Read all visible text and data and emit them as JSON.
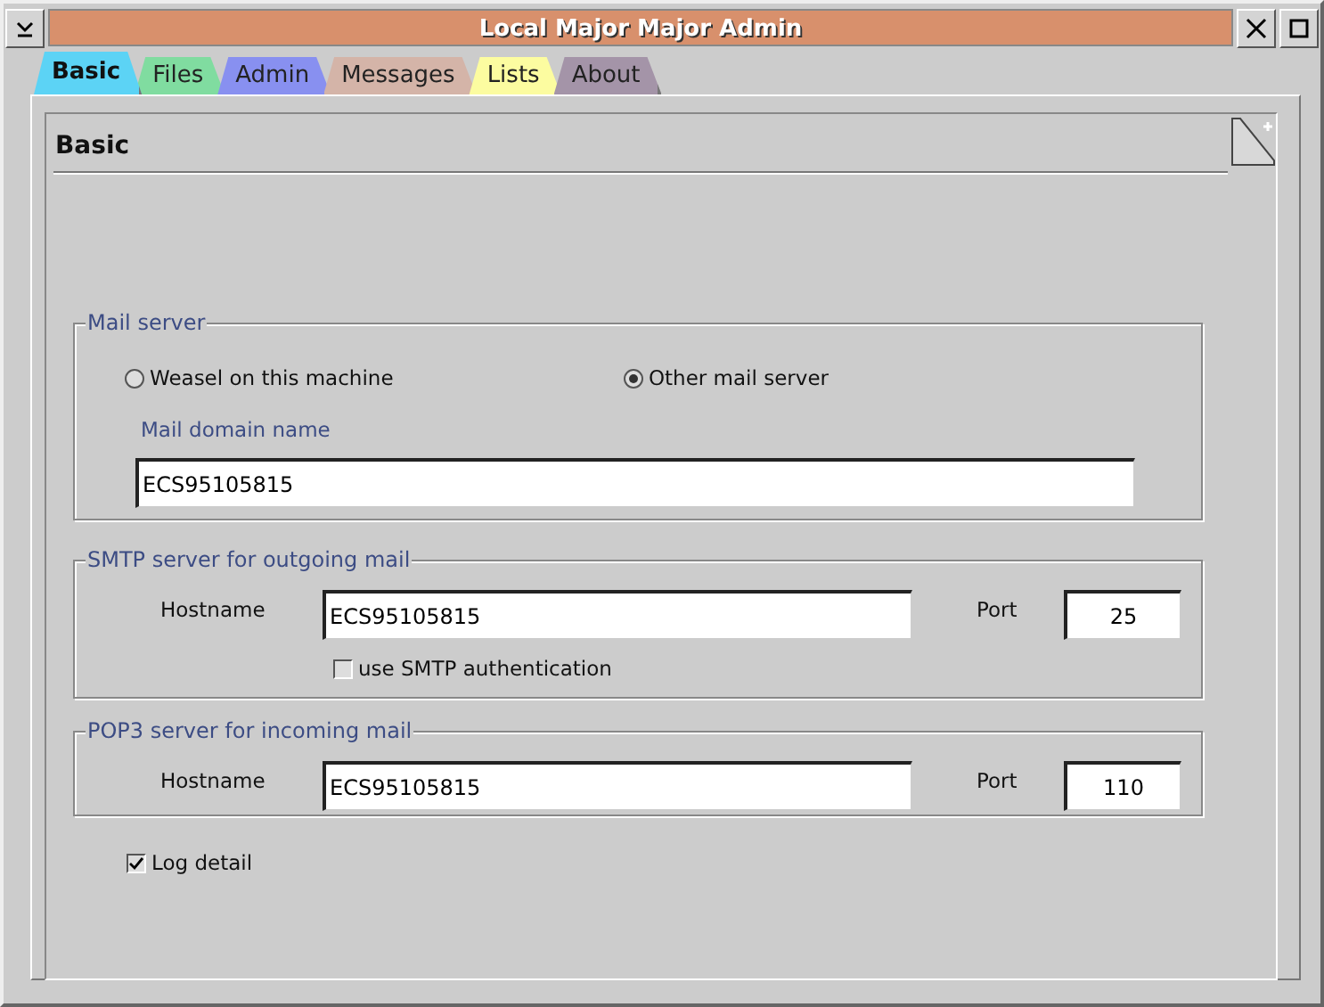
{
  "window": {
    "title": "Local Major Major Admin"
  },
  "tabs": [
    {
      "label": "Basic",
      "selected": true,
      "color": "#5cd3f5"
    },
    {
      "label": "Files",
      "selected": false,
      "color": "#80dca0"
    },
    {
      "label": "Admin",
      "selected": false,
      "color": "#8890f0"
    },
    {
      "label": "Messages",
      "selected": false,
      "color": "#d4b4a8"
    },
    {
      "label": "Lists",
      "selected": false,
      "color": "#fcfca0"
    },
    {
      "label": "About",
      "selected": false,
      "color": "#a494a8"
    }
  ],
  "page": {
    "title": "Basic"
  },
  "mail_server": {
    "legend": "Mail server",
    "options": [
      {
        "label": "Weasel on this machine",
        "selected": false
      },
      {
        "label": "Other mail server",
        "selected": true
      }
    ],
    "domain_label": "Mail domain name",
    "domain_value": "ECS95105815"
  },
  "smtp": {
    "legend": "SMTP server for outgoing mail",
    "hostname_label": "Hostname",
    "hostname": "ECS95105815",
    "port_label": "Port",
    "port": "25",
    "auth": {
      "label": "use SMTP authentication",
      "checked": false
    }
  },
  "pop3": {
    "legend": "POP3 server for incoming mail",
    "hostname_label": "Hostname",
    "hostname": "ECS95105815",
    "port_label": "Port",
    "port": "110"
  },
  "log_detail": {
    "label": "Log detail",
    "checked": true
  }
}
